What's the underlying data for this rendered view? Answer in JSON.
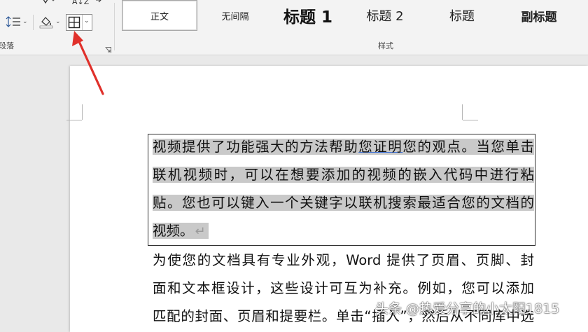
{
  "ribbon": {
    "paragraph_group_label": "段落",
    "styles_group_label": "样式",
    "sort_label": "A↓Z",
    "styles": [
      {
        "label": "正文",
        "selected": true
      },
      {
        "label": "无间隔",
        "selected": false
      },
      {
        "label": "标题 1",
        "selected": false
      },
      {
        "label": "标题 2",
        "selected": false
      },
      {
        "label": "标题",
        "selected": false
      },
      {
        "label": "副标题",
        "selected": false
      }
    ],
    "icons": {
      "line_spacing": "line-spacing-icon",
      "shading": "shading-icon",
      "borders": "borders-icon",
      "launcher": "dialog-launcher-icon"
    }
  },
  "document": {
    "selected_paragraph_lines": [
      {
        "before": "视频提供了功能强大的方法帮助",
        "underlined": "您证明",
        "after": "您的观点。当您单击"
      },
      {
        "text": "联机视频时，可以在想要添加的视频的嵌入代码中进行粘"
      },
      {
        "text": "贴。您也可以键入一个关键字以联机搜索最适合您的文档的"
      },
      {
        "text": "视频。"
      }
    ],
    "paragraph_mark": "↵",
    "next_paragraph_lines": [
      "为使您的文档具有专业外观，Word 提供了页眉、页脚、封",
      "面和文本框设计，这些设计可互为补充。例如，您可以添加",
      "匹配的封面、页眉和提要栏。单击“插入”，然后从不同库中选"
    ]
  },
  "watermark": "头条 @热爱分享的小太阳1815",
  "colors": {
    "ribbon_bg": "#f3f3f3",
    "selection_highlight": "#c9c9c9",
    "annotation_arrow": "#e0302a"
  }
}
